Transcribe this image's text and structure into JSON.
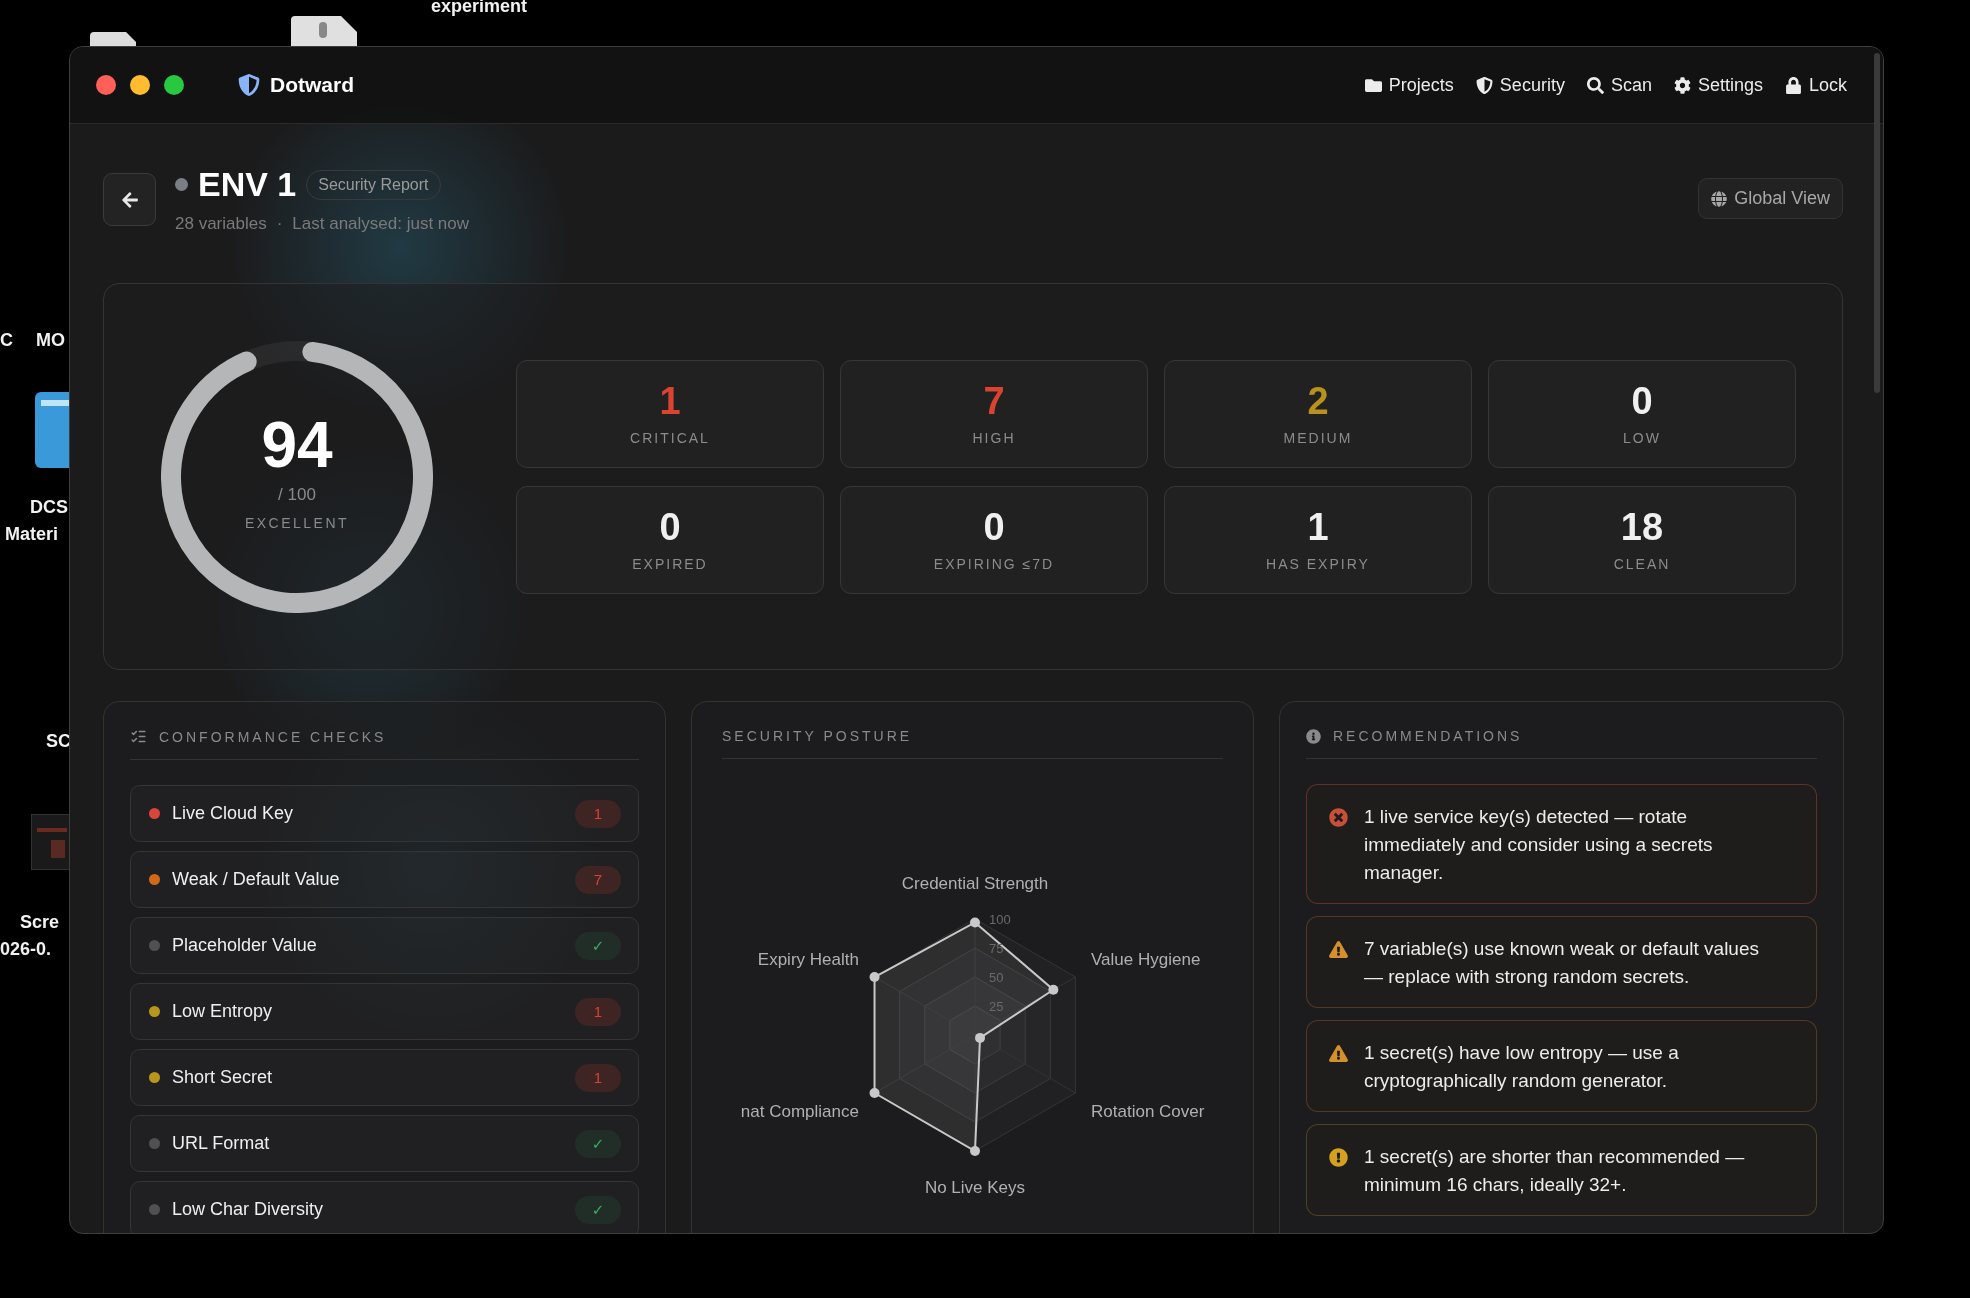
{
  "desktop": {
    "labels": [
      "experiment",
      "C",
      "MO",
      "DCS",
      "Materi",
      "SC",
      "Scre",
      "026-0."
    ]
  },
  "window": {
    "app_name": "Dotward",
    "nav": [
      {
        "label": "Projects"
      },
      {
        "label": "Security"
      },
      {
        "label": "Scan"
      },
      {
        "label": "Settings"
      },
      {
        "label": "Lock"
      }
    ]
  },
  "header": {
    "title": "ENV 1",
    "badge": "Security Report",
    "variables": "28 variables",
    "separator": "·",
    "analysed": "Last analysed: just now",
    "action": "Global View"
  },
  "score": {
    "value": "94",
    "max": "/ 100",
    "rating": "EXCELLENT",
    "level": 0.94
  },
  "stats": [
    {
      "value": "1",
      "label": "CRITICAL",
      "color": "#d9432f"
    },
    {
      "value": "7",
      "label": "HIGH",
      "color": "#d9432f"
    },
    {
      "value": "2",
      "label": "MEDIUM",
      "color": "#b8921c"
    },
    {
      "value": "0",
      "label": "LOW",
      "color": "#f0f0f0"
    },
    {
      "value": "0",
      "label": "EXPIRED",
      "color": "#f0f0f0"
    },
    {
      "value": "0",
      "label": "EXPIRING ≤7D",
      "color": "#f0f0f0"
    },
    {
      "value": "1",
      "label": "HAS EXPIRY",
      "color": "#f0f0f0"
    },
    {
      "value": "18",
      "label": "CLEAN",
      "color": "#f0f0f0"
    }
  ],
  "checks": {
    "title": "CONFORMANCE CHECKS",
    "items": [
      {
        "label": "Live Cloud Key",
        "color": "#d8453a",
        "kind": "count",
        "count": "1"
      },
      {
        "label": "Weak / Default Value",
        "color": "#d06a1a",
        "kind": "count",
        "count": "7"
      },
      {
        "label": "Placeholder Value",
        "color": "#505050",
        "kind": "pass",
        "mark": "✓"
      },
      {
        "label": "Low Entropy",
        "color": "#b8961a",
        "kind": "count",
        "count": "1"
      },
      {
        "label": "Short Secret",
        "color": "#b8961a",
        "kind": "count",
        "count": "1"
      },
      {
        "label": "URL Format",
        "color": "#505050",
        "kind": "pass",
        "mark": "✓"
      },
      {
        "label": "Low Char Diversity",
        "color": "#505050",
        "kind": "pass",
        "mark": "✓"
      }
    ]
  },
  "posture": {
    "title": "SECURITY POSTURE",
    "chart_data": {
      "type": "radar",
      "categories": [
        "Credential Strength",
        "Value Hygiene",
        "Rotation Cover",
        "No Live Keys",
        "nat Compliance",
        "Expiry Health"
      ],
      "series": [
        {
          "color": "#c8c8c8",
          "values": [
            97,
            78,
            5,
            100,
            100,
            100
          ]
        }
      ],
      "ylim": [
        0,
        100
      ],
      "yticks": [
        25,
        50,
        75,
        100
      ]
    }
  },
  "recommendations": {
    "title": "RECOMMENDATIONS",
    "items": [
      {
        "kind": "error",
        "text": "1 live service key(s) detected — rotate immediately and consider using a secrets manager."
      },
      {
        "kind": "warning",
        "text": "7 variable(s) use known weak or default values — replace with strong random secrets."
      },
      {
        "kind": "warning",
        "text": "1 secret(s) have low entropy — use a cryptographically random generator."
      },
      {
        "kind": "caution",
        "text": "1 secret(s) are shorter than recommended — minimum 16 chars, ideally 32+."
      }
    ]
  }
}
